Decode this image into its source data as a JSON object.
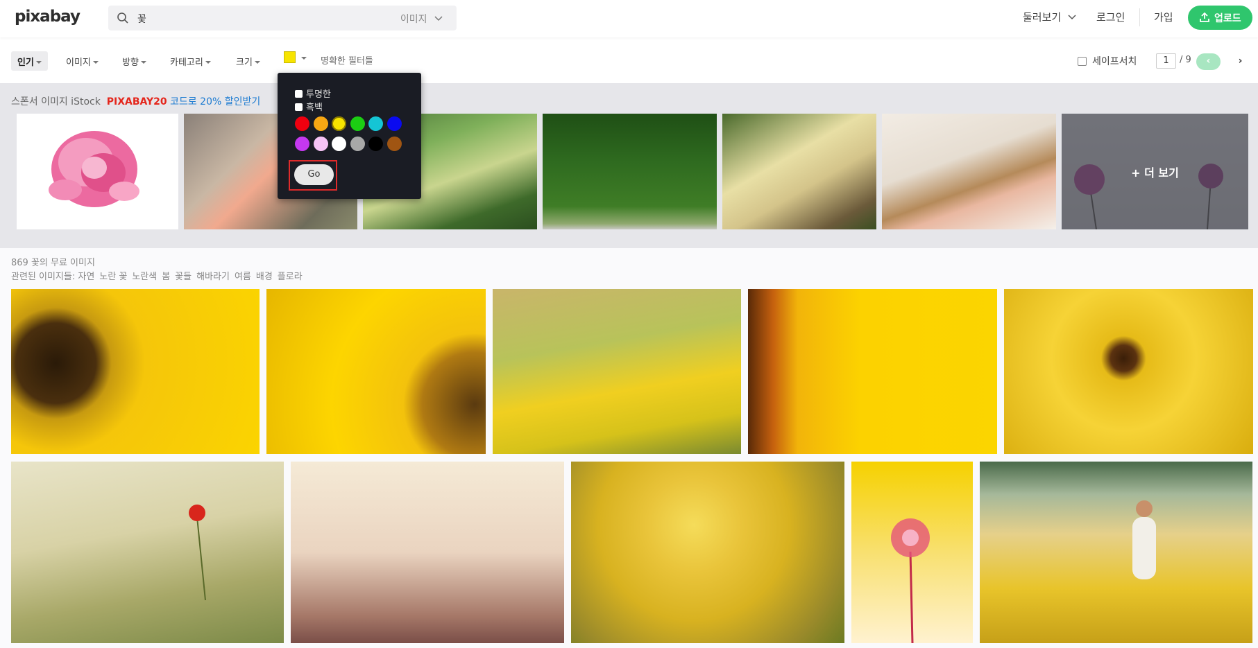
{
  "header": {
    "logo": "pixabay",
    "search_value": "꽃",
    "search_type": "이미지",
    "explore_label": "둘러보기",
    "login_label": "로그인",
    "signup_label": "가입",
    "upload_label": "업로드",
    "accent_color": "#2fc66d"
  },
  "filters": {
    "popular": "인기",
    "image": "이미지",
    "orientation": "방향",
    "category": "카테고리",
    "size": "크기",
    "selected_color": "#f7e400",
    "clear_filters": "명확한 필터들",
    "safesearch_label": "세이프서치",
    "page_current": "1",
    "page_total": "/ 9",
    "prev_icon": "‹",
    "next_icon": "›"
  },
  "color_popup": {
    "transparent_label": "투명한",
    "bw_label": "흑백",
    "colors_row1": [
      "#f0000f",
      "#f7a713",
      "#f7e400",
      "#1ccd13",
      "#15c5d5",
      "#0a0af0"
    ],
    "colors_row2": [
      "#c538f0",
      "#f6c3f5",
      "#ffffff",
      "#a8a8a8",
      "#000000",
      "#a05512"
    ],
    "selected": "#f7e400",
    "go_label": "Go"
  },
  "sponsor": {
    "prefix": "스폰서 이미지 iStock",
    "code": "PIXABAY20",
    "discount": "코드로 20% 할인받기",
    "more_label": "+ 더 보기"
  },
  "results": {
    "count_text": "869 꽃의 무료 이미지",
    "related_label": "관련된 이미지들:",
    "related_tags": [
      "자연",
      "노란 꽃",
      "노란색",
      "봄",
      "꽃들",
      "해바라기",
      "여름",
      "배경",
      "플로라"
    ]
  }
}
